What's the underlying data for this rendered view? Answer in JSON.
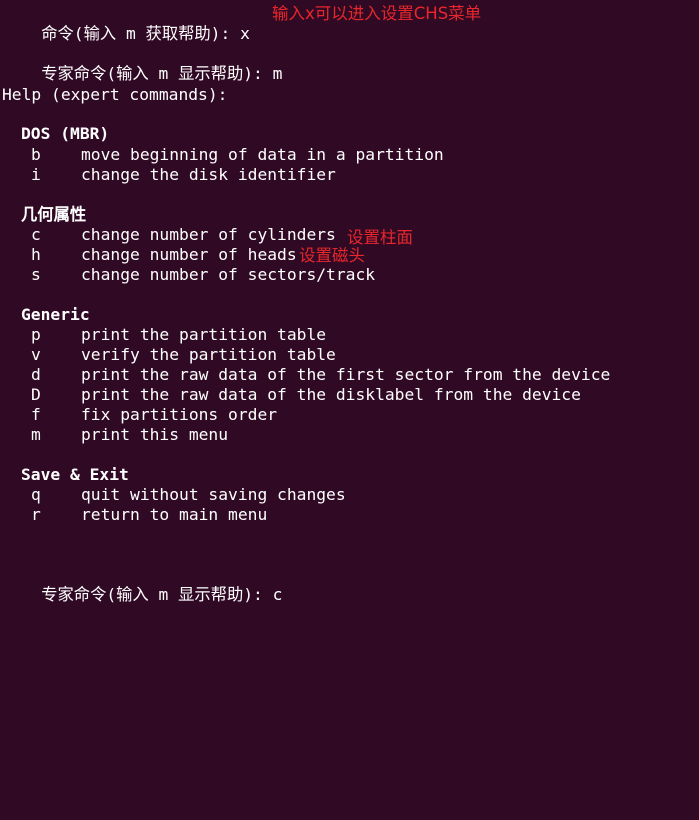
{
  "colors": {
    "background": "#300a24",
    "text": "#ffffff",
    "annotation": "#e8262c"
  },
  "top": {
    "prompt": "命令(输入 m 获取帮助): ",
    "input": "x",
    "annotation": "输入x可以进入设置CHS菜单"
  },
  "expert_prompt_1": {
    "prompt": "专家命令(输入 m 显示帮助): ",
    "input": "m"
  },
  "help_header": "Help (expert commands):",
  "sections": {
    "dos": {
      "title": "DOS (MBR)",
      "items": [
        {
          "key": "b",
          "desc": "move beginning of data in a partition"
        },
        {
          "key": "i",
          "desc": "change the disk identifier"
        }
      ]
    },
    "geometry": {
      "title": "几何属性",
      "items": [
        {
          "key": "c",
          "desc": "change number of cylinders"
        },
        {
          "key": "h",
          "desc": "change number of heads"
        },
        {
          "key": "s",
          "desc": "change number of sectors/track"
        }
      ],
      "annotations": {
        "cylinders": "设置柱面",
        "heads": "设置磁头"
      }
    },
    "generic": {
      "title": "Generic",
      "items": [
        {
          "key": "p",
          "desc": "print the partition table"
        },
        {
          "key": "v",
          "desc": "verify the partition table"
        },
        {
          "key": "d",
          "desc": "print the raw data of the first sector from the device"
        },
        {
          "key": "D",
          "desc": "print the raw data of the disklabel from the device"
        },
        {
          "key": "f",
          "desc": "fix partitions order"
        },
        {
          "key": "m",
          "desc": "print this menu"
        }
      ]
    },
    "save_exit": {
      "title": "Save & Exit",
      "items": [
        {
          "key": "q",
          "desc": "quit without saving changes"
        },
        {
          "key": "r",
          "desc": "return to main menu"
        }
      ]
    }
  },
  "expert_prompt_2": {
    "prompt": "专家命令(输入 m 显示帮助): ",
    "input": "c"
  }
}
